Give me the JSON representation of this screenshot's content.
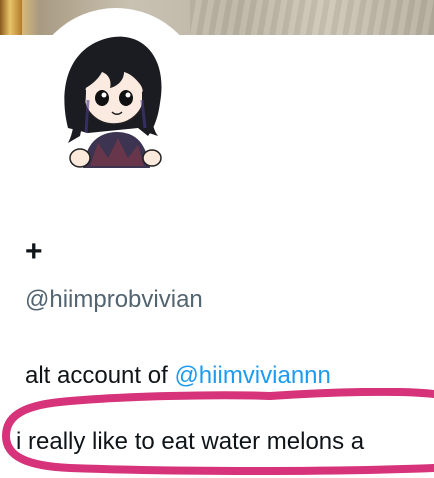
{
  "profile": {
    "display_name": "+",
    "handle": "@hiimprobvivian",
    "bio_prefix": "alt account of ",
    "bio_mention": "@hiimviviannn",
    "bio_line2": "i really like to eat water melons a"
  },
  "annotation": {
    "color": "#d6337b"
  },
  "icons": {
    "avatar": "anime-girl-avatar"
  }
}
